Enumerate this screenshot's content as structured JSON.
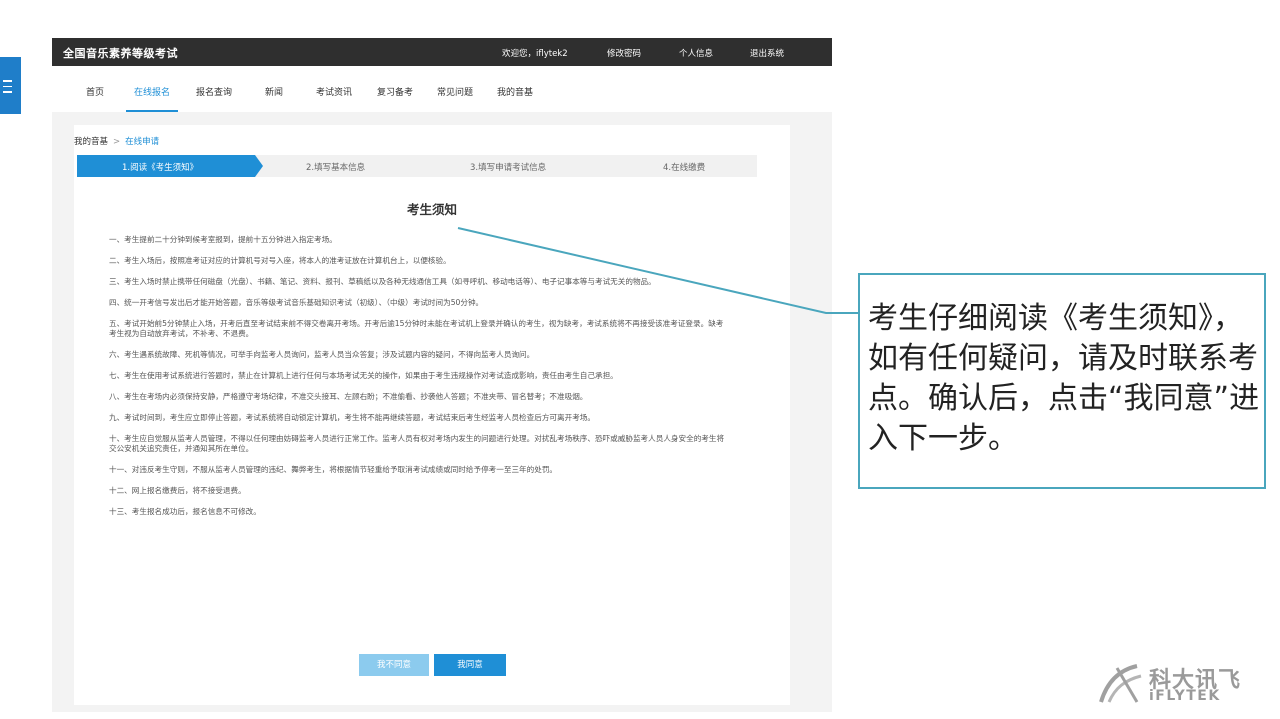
{
  "topbar": {
    "title": "全国音乐素养等级考试",
    "welcome": "欢迎您，iflytek2",
    "change_password": "修改密码",
    "profile": "个人信息",
    "logout": "退出系统"
  },
  "nav": {
    "items": [
      "首页",
      "在线报名",
      "报名查询",
      "新闻",
      "考试资讯",
      "复习备考",
      "常见问题",
      "我的音基"
    ],
    "active": "在线报名"
  },
  "breadcrumb": {
    "root": "我的音基",
    "sep": ">",
    "current": "在线申请"
  },
  "steps": [
    "1.阅读《考生须知》",
    "2.填写基本信息",
    "3.填写申请考试信息",
    "4.在线缴费"
  ],
  "notice": {
    "title": "考生须知",
    "rules": [
      "一、考生提前二十分钟到候考室报到，提前十五分钟进入指定考场。",
      "二、考生入场后，按照准考证对应的计算机号对号入座，将本人的准考证放在计算机台上，以便核验。",
      "三、考生入场时禁止携带任何磁盘（光盘）、书籍、笔记、资料、报刊、草稿纸以及各种无线通信工具（如寻呼机、移动电话等）、电子记事本等与考试无关的物品。",
      "四、统一开考信号发出后才能开始答题，音乐等级考试音乐基础知识考试（初级）、（中级）考试时间为50分钟。",
      "五、考试开始前5分钟禁止入场，开考后直至考试结束前不得交卷离开考场。开考后逾15分钟时未能在考试机上登录并确认的考生，视为缺考，考试系统将不再接受该准考证登录。缺考考生视为自动放弃考试，不补考、不退费。",
      "六、考生遇系统故障、死机等情况，可举手向监考人员询问，监考人员当众答复；涉及试题内容的疑问，不得向监考人员询问。",
      "七、考生在使用考试系统进行答题时，禁止在计算机上进行任何与本场考试无关的操作，如果由于考生违规操作对考试造成影响，责任由考生自己承担。",
      "八、考生在考场内必须保持安静，严格遵守考场纪律，不准交头接耳、左顾右盼；不准偷看、抄袭他人答题；不准夹带、冒名替考；不准吸烟。",
      "九、考试时间到，考生应立即停止答题，考试系统将自动锁定计算机，考生将不能再继续答题，考试结束后考生经监考人员检查后方可离开考场。",
      "十、考生应自觉服从监考人员管理，不得以任何理由妨碍监考人员进行正常工作。监考人员有权对考场内发生的问题进行处理。对扰乱考场秩序、恐吓或威胁监考人员人身安全的考生将交公安机关追究责任，并通知其所在单位。",
      "十一、对违反考生守则，不服从监考人员管理的违纪、舞弊考生，将根据情节轻重给予取消考试成绩或同时给予停考一至三年的处罚。",
      "十二、网上报名缴费后，将不接受退费。",
      "十三、考生报名成功后，报名信息不可修改。"
    ]
  },
  "buttons": {
    "disagree": "我不同意",
    "agree": "我同意"
  },
  "callout": {
    "text": "考生仔细阅读《考生须知》，如有任何疑问，请及时联系考点。确认后，点击“我同意”进入下一步。"
  },
  "logo": {
    "cn": "科大讯飞",
    "en": "iFLYTEK"
  },
  "colors": {
    "accent": "#1f8fd6",
    "topbar": "#2f2f2f",
    "callout_border": "#4aa6bd"
  }
}
